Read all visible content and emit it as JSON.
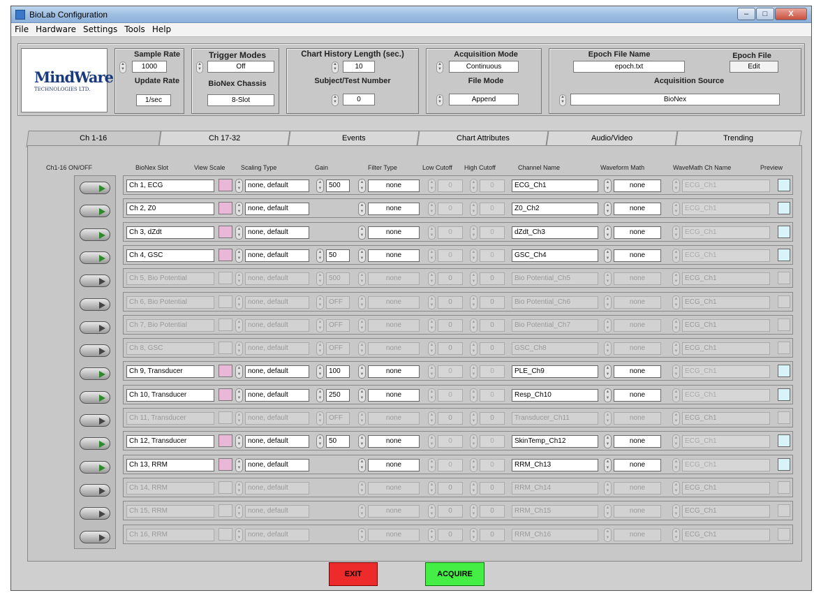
{
  "window": {
    "title": "BioLab Configuration",
    "min": "–",
    "max": "□",
    "close": "X"
  },
  "menu": [
    "File",
    "Hardware",
    "Settings",
    "Tools",
    "Help"
  ],
  "logo": {
    "line1": "MindWare",
    "line2": "TECHNOLOGIES LTD."
  },
  "header": {
    "sample_rate_label": "Sample Rate",
    "sample_rate": "1000",
    "update_rate_label": "Update Rate",
    "update_rate": "1/sec",
    "trigger_label": "Trigger Modes",
    "trigger": "Off",
    "chassis_label": "BioNex Chassis",
    "chassis": "8-Slot",
    "history_label": "Chart History Length (sec.)",
    "history": "10",
    "subject_label": "Subject/Test Number",
    "subject": "0",
    "acq_mode_label": "Acquisition Mode",
    "acq_mode": "Continuous",
    "file_mode_label": "File Mode",
    "file_mode": "Append",
    "epoch_name_label": "Epoch File Name",
    "epoch_name": "epoch.txt",
    "epoch_file_label": "Epoch File",
    "epoch_edit": "Edit",
    "acq_source_label": "Acquisition Source",
    "acq_source": "BioNex"
  },
  "tabs": [
    "Ch 1-16",
    "Ch 17-32",
    "Events",
    "Chart Attributes",
    "Audio/Video",
    "Trending"
  ],
  "columns": {
    "onoff": "Ch1-16 ON/OFF",
    "slot": "BioNex Slot",
    "scale": "View Scale",
    "scaling": "Scaling Type",
    "gain": "Gain",
    "filter": "Filter Type",
    "low": "Low Cutoff",
    "high": "High Cutoff",
    "name": "Channel Name",
    "math": "Waveform Math",
    "mathname": "WaveMath Ch Name",
    "preview": "Preview"
  },
  "rows": [
    {
      "on": true,
      "slot": "Ch 1, ECG",
      "scaling": "none, default",
      "gain": "500",
      "filter": "none",
      "low": "0",
      "high": "0",
      "name": "ECG_Ch1",
      "math": "none",
      "mathname": "ECG_Ch1"
    },
    {
      "on": true,
      "slot": "Ch 2, Z0",
      "scaling": "none, default",
      "gain": "",
      "filter": "none",
      "low": "0",
      "high": "0",
      "name": "Z0_Ch2",
      "math": "none",
      "mathname": "ECG_Ch1"
    },
    {
      "on": true,
      "slot": "Ch 3, dZdt",
      "scaling": "none, default",
      "gain": "",
      "filter": "none",
      "low": "0",
      "high": "0",
      "name": "dZdt_Ch3",
      "math": "none",
      "mathname": "ECG_Ch1"
    },
    {
      "on": true,
      "slot": "Ch 4, GSC",
      "scaling": "none, default",
      "gain": "50",
      "filter": "none",
      "low": "0",
      "high": "0",
      "name": "GSC_Ch4",
      "math": "none",
      "mathname": "ECG_Ch1"
    },
    {
      "on": false,
      "slot": "Ch 5, Bio Potential",
      "scaling": "none, default",
      "gain": "500",
      "filter": "none",
      "low": "0",
      "high": "0",
      "name": "Bio Potential_Ch5",
      "math": "none",
      "mathname": "ECG_Ch1"
    },
    {
      "on": false,
      "slot": "Ch 6, Bio Potential",
      "scaling": "none, default",
      "gain": "OFF",
      "filter": "none",
      "low": "0",
      "high": "0",
      "name": "Bio Potential_Ch6",
      "math": "none",
      "mathname": "ECG_Ch1"
    },
    {
      "on": false,
      "slot": "Ch 7, Bio Potential",
      "scaling": "none, default",
      "gain": "OFF",
      "filter": "none",
      "low": "0",
      "high": "0",
      "name": "Bio Potential_Ch7",
      "math": "none",
      "mathname": "ECG_Ch1"
    },
    {
      "on": false,
      "slot": "Ch 8, GSC",
      "scaling": "none, default",
      "gain": "OFF",
      "filter": "none",
      "low": "0",
      "high": "0",
      "name": "GSC_Ch8",
      "math": "none",
      "mathname": "ECG_Ch1"
    },
    {
      "on": true,
      "slot": "Ch 9, Transducer",
      "scaling": "none, default",
      "gain": "100",
      "filter": "none",
      "low": "0",
      "high": "0",
      "name": "PLE_Ch9",
      "math": "none",
      "mathname": "ECG_Ch1"
    },
    {
      "on": true,
      "slot": "Ch 10, Transducer",
      "scaling": "none, default",
      "gain": "250",
      "filter": "none",
      "low": "0",
      "high": "0",
      "name": "Resp_Ch10",
      "math": "none",
      "mathname": "ECG_Ch1"
    },
    {
      "on": false,
      "slot": "Ch 11, Transducer",
      "scaling": "none, default",
      "gain": "OFF",
      "filter": "none",
      "low": "0",
      "high": "0",
      "name": "Transducer_Ch11",
      "math": "none",
      "mathname": "ECG_Ch1"
    },
    {
      "on": true,
      "slot": "Ch 12, Transducer",
      "scaling": "none, default",
      "gain": "50",
      "filter": "none",
      "low": "0",
      "high": "0",
      "name": "SkinTemp_Ch12",
      "math": "none",
      "mathname": "ECG_Ch1"
    },
    {
      "on": true,
      "slot": "Ch 13, RRM",
      "scaling": "none, default",
      "gain": "",
      "filter": "none",
      "low": "0",
      "high": "0",
      "name": "RRM_Ch13",
      "math": "none",
      "mathname": "ECG_Ch1"
    },
    {
      "on": false,
      "slot": "Ch 14, RRM",
      "scaling": "none, default",
      "gain": "",
      "filter": "none",
      "low": "0",
      "high": "0",
      "name": "RRM_Ch14",
      "math": "none",
      "mathname": "ECG_Ch1"
    },
    {
      "on": false,
      "slot": "Ch 15, RRM",
      "scaling": "none, default",
      "gain": "",
      "filter": "none",
      "low": "0",
      "high": "0",
      "name": "RRM_Ch15",
      "math": "none",
      "mathname": "ECG_Ch1"
    },
    {
      "on": false,
      "slot": "Ch 16, RRM",
      "scaling": "none, default",
      "gain": "",
      "filter": "none",
      "low": "0",
      "high": "0",
      "name": "RRM_Ch16",
      "math": "none",
      "mathname": "ECG_Ch1"
    }
  ],
  "buttons": {
    "exit": "EXIT",
    "acquire": "ACQUIRE"
  }
}
